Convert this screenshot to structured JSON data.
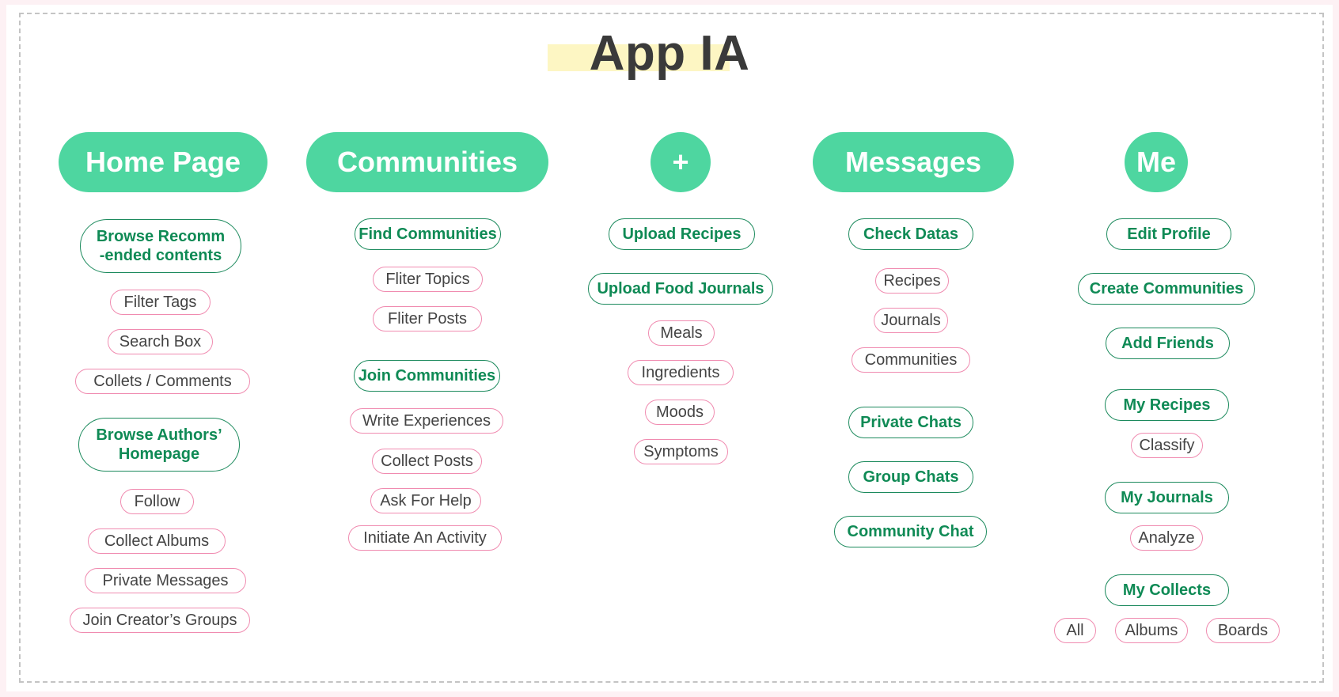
{
  "title": "App IA",
  "columns": {
    "home": {
      "header": "Home Page",
      "nodes": {
        "browse_recommended": "Browse Recomm\n-ended contents",
        "filter_tags": "Filter Tags",
        "search_box": "Search Box",
        "collets_comments": "Collets / Comments",
        "browse_authors": "Browse Authors’\nHomepage",
        "follow": "Follow",
        "collect_albums": "Collect Albums",
        "private_messages": "Private Messages",
        "join_creators_groups": "Join Creator’s Groups"
      }
    },
    "communities": {
      "header": "Communities",
      "nodes": {
        "find_communities": "Find Communities",
        "fliter_topics": "Fliter Topics",
        "fliter_posts": "Fliter Posts",
        "join_communities": "Join Communities",
        "write_experiences": "Write Experiences",
        "collect_posts": "Collect Posts",
        "ask_for_help": "Ask For Help",
        "initiate_activity": "Initiate An Activity"
      }
    },
    "plus": {
      "header": "+",
      "nodes": {
        "upload_recipes": "Upload Recipes",
        "upload_food_journals": "Upload Food Journals",
        "meals": "Meals",
        "ingredients": "Ingredients",
        "moods": "Moods",
        "symptoms": "Symptoms"
      }
    },
    "messages": {
      "header": "Messages",
      "nodes": {
        "check_datas": "Check Datas",
        "recipes": "Recipes",
        "journals": "Journals",
        "communities": "Communities",
        "private_chats": "Private Chats",
        "group_chats": "Group Chats",
        "community_chat": "Community Chat"
      }
    },
    "me": {
      "header": "Me",
      "nodes": {
        "edit_profile": "Edit Profile",
        "create_communities": "Create Communities",
        "add_friends": "Add Friends",
        "my_recipes": "My Recipes",
        "classify": "Classify",
        "my_journals": "My Journals",
        "analyze": "Analyze",
        "my_collects": "My Collects",
        "all": "All",
        "albums": "Albums",
        "boards": "Boards"
      }
    }
  },
  "colors": {
    "header_bg": "#4ed6a0",
    "primary_border": "#1c8a5d",
    "primary_text": "#0f8a55",
    "secondary_border": "#f08bb0",
    "title_highlight": "#fdf6c3"
  }
}
